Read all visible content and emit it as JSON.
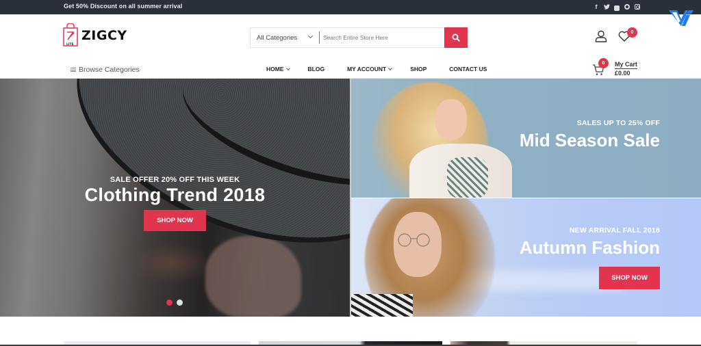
{
  "topbar": {
    "promo": "Get 50% Discount on all summer arrival",
    "socials": [
      "facebook",
      "twitter",
      "youtube",
      "pinterest",
      "instagram"
    ],
    "social_glyphs": {
      "facebook": "f",
      "twitter": "t"
    }
  },
  "header": {
    "logo_text": "ZIGCY",
    "logo_sub": "LITE",
    "search": {
      "category": "All Categories",
      "placeholder": "Search Entire Store Here",
      "value": ""
    },
    "wishlist_count": "0",
    "cart": {
      "count": "0",
      "label": "My Cart",
      "amount": "£0.00"
    }
  },
  "nav": {
    "browse_label": "Browse Categories",
    "items": [
      {
        "label": "HOME",
        "dropdown": true
      },
      {
        "label": "BLOG",
        "dropdown": false
      },
      {
        "label": "MY ACCOUNT",
        "dropdown": true
      },
      {
        "label": "SHOP",
        "dropdown": false
      },
      {
        "label": "CONTACT US",
        "dropdown": false
      }
    ]
  },
  "hero": {
    "main_slide": {
      "kicker": "SALE OFFER 20% OFF THIS WEEK",
      "title": "Clothing Trend 2018",
      "button": "SHOP NOW"
    },
    "slider": {
      "total": 2,
      "active": 1
    },
    "banner_top": {
      "kicker": "SALES UP TO 25% OFF",
      "title": "Mid Season Sale"
    },
    "banner_bottom": {
      "kicker": "NEW ARRIVAL FALL 2018",
      "title": "Autumn Fashion",
      "button": "SHOP NOW"
    }
  },
  "colors": {
    "accent": "#e0344f",
    "topbar_bg": "#2a303b",
    "dot_inactive": "#d9e4e4"
  }
}
